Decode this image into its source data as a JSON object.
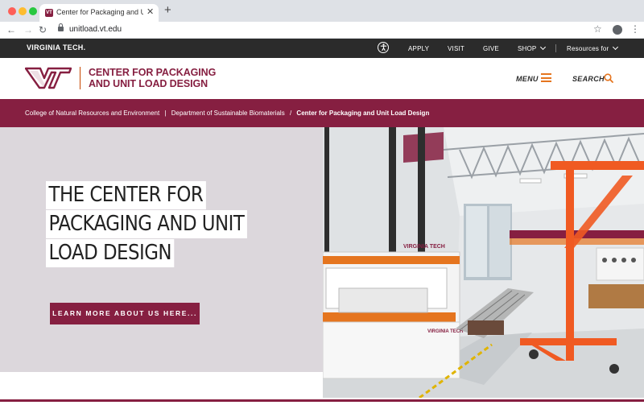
{
  "browser": {
    "tab_title": "Center for Packaging and Unit L",
    "tab_favicon_text": "VT",
    "tab_close": "✕",
    "new_tab": "+",
    "url": "unitload.vt.edu",
    "icons": [
      "back-arrow-icon",
      "forward-arrow-icon",
      "reload-icon",
      "lock-icon",
      "star-icon",
      "profile-icon",
      "kebab-menu-icon"
    ]
  },
  "global_bar": {
    "wordmark": "VIRGINIA TECH.",
    "accessibility_icon_glyph": "✦",
    "links": [
      {
        "label": "APPLY"
      },
      {
        "label": "VISIT"
      },
      {
        "label": "GIVE"
      },
      {
        "label": "SHOP"
      },
      {
        "label": "Resources for"
      }
    ]
  },
  "header": {
    "site_title_line1": "CENTER FOR PACKAGING",
    "site_title_line2": "AND UNIT LOAD DESIGN",
    "menu_label": "MENU",
    "search_label": "SEARCH",
    "brand_colors": {
      "maroon": "#861f41",
      "orange": "#e5751f",
      "dark": "#2b2b2b"
    }
  },
  "breadcrumb": {
    "items": [
      "College of Natural Resources and Environment",
      "Department of Sustainable Biomaterials",
      "Center for Packaging and Unit Load Design"
    ],
    "separators": [
      "|",
      "/"
    ]
  },
  "hero": {
    "headline_lines": [
      "THE CENTER FOR",
      "PACKAGING AND UNIT",
      "LOAD DESIGN"
    ],
    "button_label": "LEARN MORE ABOUT US HERE...",
    "photo_signage": [
      "VIRGINIA TECH",
      "VIRGINIA TECH"
    ]
  }
}
